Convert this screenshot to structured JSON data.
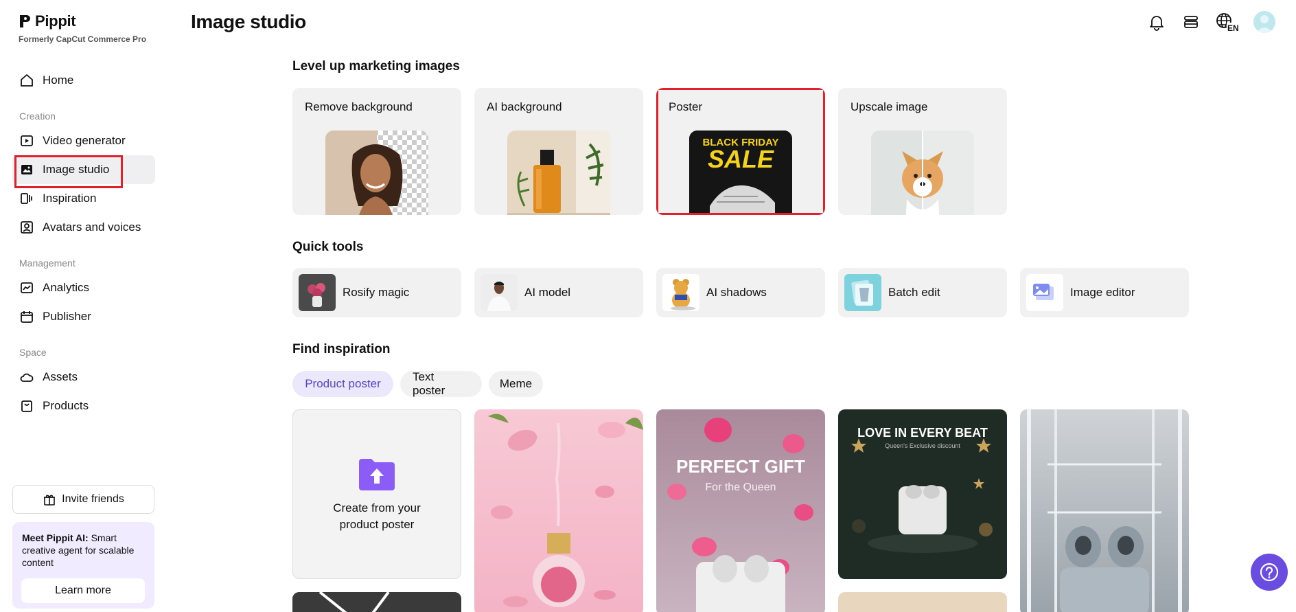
{
  "brand": {
    "name": "Pippit",
    "subtitle": "Formerly CapCut Commerce Pro"
  },
  "sidebar": {
    "home": "Home",
    "creation_label": "Creation",
    "creation": [
      "Video generator",
      "Image studio",
      "Inspiration",
      "Avatars and voices"
    ],
    "management_label": "Management",
    "management": [
      "Analytics",
      "Publisher"
    ],
    "space_label": "Space",
    "space": [
      "Assets",
      "Products"
    ],
    "invite": "Invite friends",
    "promo_bold": "Meet Pippit AI:",
    "promo_text": " Smart creative agent for scalable content",
    "promo_button": "Learn more"
  },
  "header": {
    "title": "Image studio",
    "lang": "EN"
  },
  "sections": {
    "marketing": "Level up marketing images",
    "quick": "Quick tools",
    "inspiration": "Find inspiration"
  },
  "features": [
    "Remove background",
    "AI background",
    "Poster",
    "Upscale image"
  ],
  "poster_thumb": {
    "line1": "BLACK FRIDAY",
    "line2": "SALE"
  },
  "tools": [
    "Rosify magic",
    "AI model",
    "AI shadows",
    "Batch edit",
    "Image editor"
  ],
  "chips": [
    "Product poster",
    "Text poster",
    "Meme"
  ],
  "gallery": {
    "create_line1": "Create from your",
    "create_line2": "product poster",
    "gift_title": "PERFECT GIFT",
    "gift_sub": "For the Queen",
    "beat_title": "LOVE IN EVERY BEAT",
    "beat_sub": "Queen's Exclusive discount"
  },
  "colors": {
    "accent": "#6a4de0",
    "highlight": "#e0202a",
    "chip_active": "#5a45c8"
  }
}
